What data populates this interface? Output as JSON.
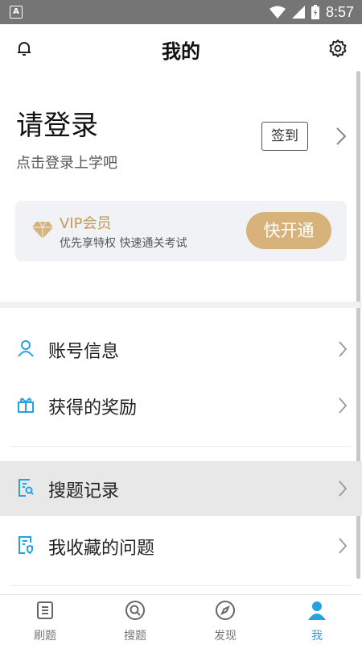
{
  "statusbar": {
    "left_icon": "A",
    "time": "8:57"
  },
  "header": {
    "title": "我的",
    "left_icon": "bell-icon",
    "right_icon": "gear-icon"
  },
  "profile": {
    "title": "请登录",
    "subtitle": "点击登录上学吧",
    "checkin_label": "签到"
  },
  "vip": {
    "title": "VIP会员",
    "subtitle": "优先享特权 快速通关考试",
    "button_label": "快开通",
    "accent": "#d7b27a"
  },
  "menu": [
    {
      "label": "账号信息",
      "icon": "user-icon"
    },
    {
      "label": "获得的奖励",
      "icon": "gift-icon"
    },
    {
      "label": "搜题记录",
      "icon": "search-record-icon"
    },
    {
      "label": "我收藏的问题",
      "icon": "favorite-doc-icon"
    }
  ],
  "bottom_nav": [
    {
      "label": "刷题",
      "icon": "list-icon"
    },
    {
      "label": "搜题",
      "icon": "search-icon"
    },
    {
      "label": "发现",
      "icon": "compass-icon"
    },
    {
      "label": "我",
      "icon": "person-icon",
      "active": true
    }
  ],
  "colors": {
    "accent": "#27a1e6",
    "vip_gold": "#c49a55"
  }
}
